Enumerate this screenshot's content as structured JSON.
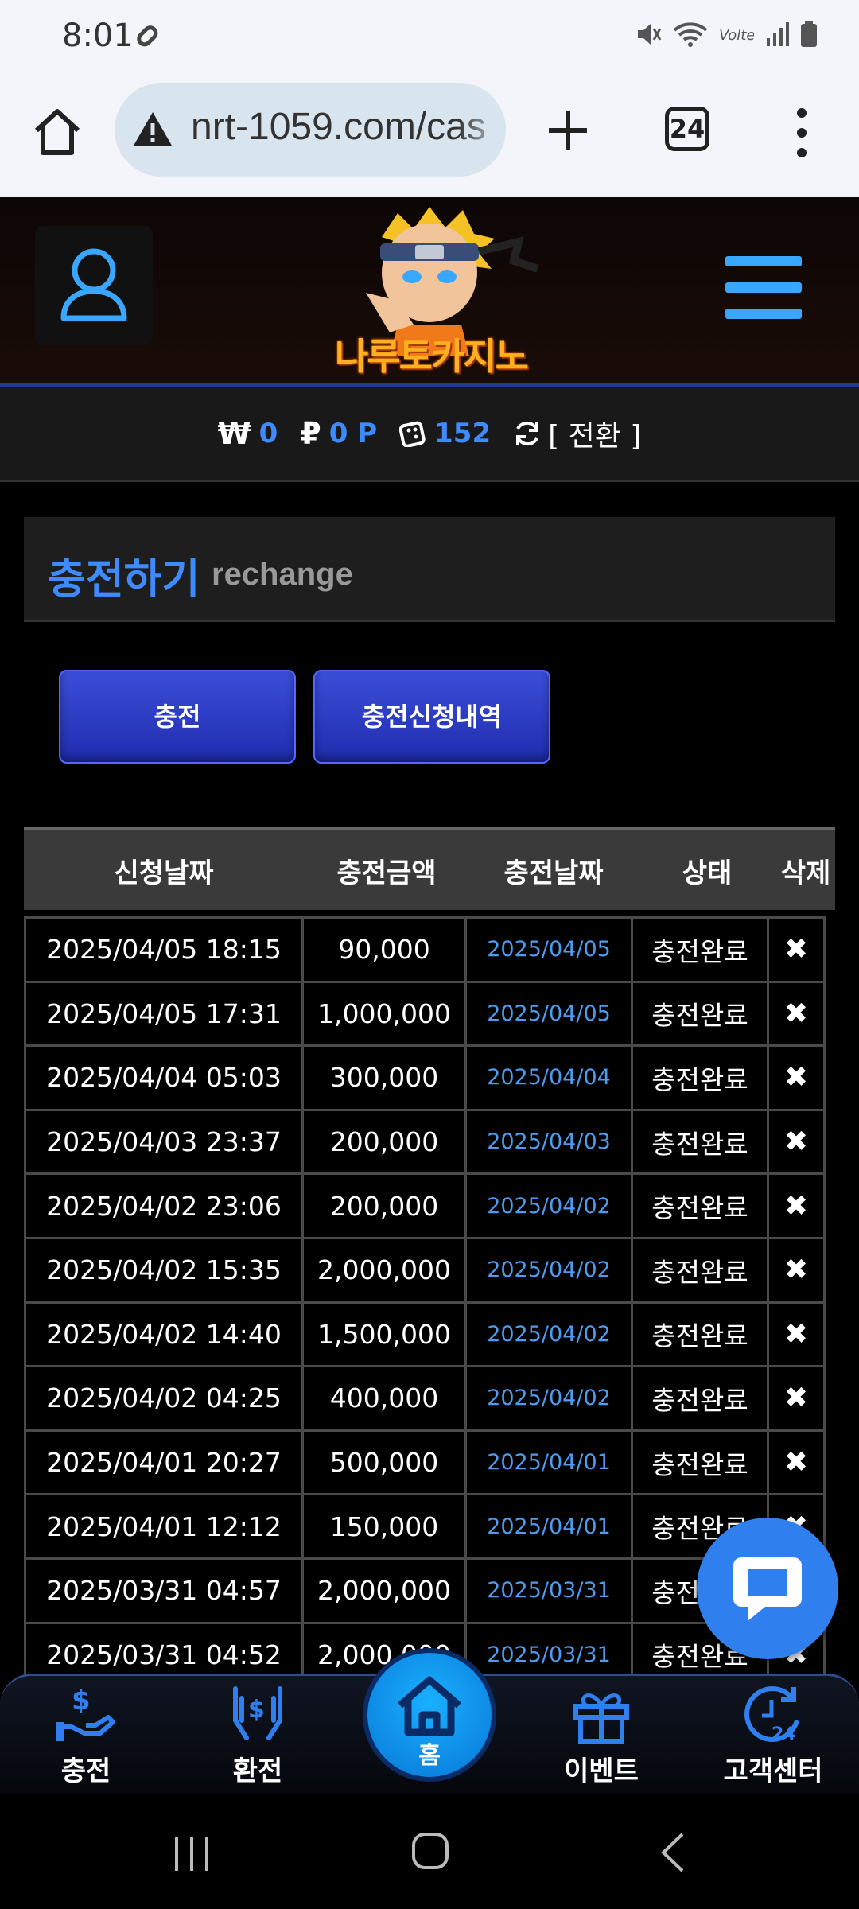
{
  "status_bar": {
    "time": "8:01"
  },
  "browser": {
    "url": "nrt-1059.com/cas",
    "tab_count": "24"
  },
  "site": {
    "logo_text": "나루토카지노"
  },
  "balance": {
    "money_symbol": "₩",
    "money": "0",
    "point_symbol": "₽",
    "point": "0 P",
    "dice": "152",
    "switch_label": "[ 전환 ]"
  },
  "section": {
    "title_ko": "충전하기",
    "title_en": "rechange"
  },
  "buttons": {
    "charge": "충전",
    "history": "충전신청내역"
  },
  "table": {
    "headers": [
      "신청날짜",
      "충전금액",
      "충전날짜",
      "상태",
      "삭제"
    ],
    "rows": [
      {
        "requested": "2025/04/05 18:15",
        "amount": "90,000",
        "date": "2025/04/05",
        "status": "충전완료",
        "del": "✖"
      },
      {
        "requested": "2025/04/05 17:31",
        "amount": "1,000,000",
        "date": "2025/04/05",
        "status": "충전완료",
        "del": "✖"
      },
      {
        "requested": "2025/04/04 05:03",
        "amount": "300,000",
        "date": "2025/04/04",
        "status": "충전완료",
        "del": "✖"
      },
      {
        "requested": "2025/04/03 23:37",
        "amount": "200,000",
        "date": "2025/04/03",
        "status": "충전완료",
        "del": "✖"
      },
      {
        "requested": "2025/04/02 23:06",
        "amount": "200,000",
        "date": "2025/04/02",
        "status": "충전완료",
        "del": "✖"
      },
      {
        "requested": "2025/04/02 15:35",
        "amount": "2,000,000",
        "date": "2025/04/02",
        "status": "충전완료",
        "del": "✖"
      },
      {
        "requested": "2025/04/02 14:40",
        "amount": "1,500,000",
        "date": "2025/04/02",
        "status": "충전완료",
        "del": "✖"
      },
      {
        "requested": "2025/04/02 04:25",
        "amount": "400,000",
        "date": "2025/04/02",
        "status": "충전완료",
        "del": "✖"
      },
      {
        "requested": "2025/04/01 20:27",
        "amount": "500,000",
        "date": "2025/04/01",
        "status": "충전완료",
        "del": "✖"
      },
      {
        "requested": "2025/04/01 12:12",
        "amount": "150,000",
        "date": "2025/04/01",
        "status": "충전완료",
        "del": "✖"
      },
      {
        "requested": "2025/03/31 04:57",
        "amount": "2,000,000",
        "date": "2025/03/31",
        "status": "충전완료",
        "del": "✖"
      },
      {
        "requested": "2025/03/31 04:52",
        "amount": "2,000,000",
        "date": "2025/03/31",
        "status": "충전완료",
        "del": "✖"
      }
    ]
  },
  "nav": {
    "charge": "충전",
    "exchange": "환전",
    "home": "홈",
    "event": "이벤트",
    "support": "고객센터"
  },
  "colors": {
    "accent": "#3d8bff",
    "button": "#2a3bc8",
    "header_border": "#1d3c8c"
  }
}
